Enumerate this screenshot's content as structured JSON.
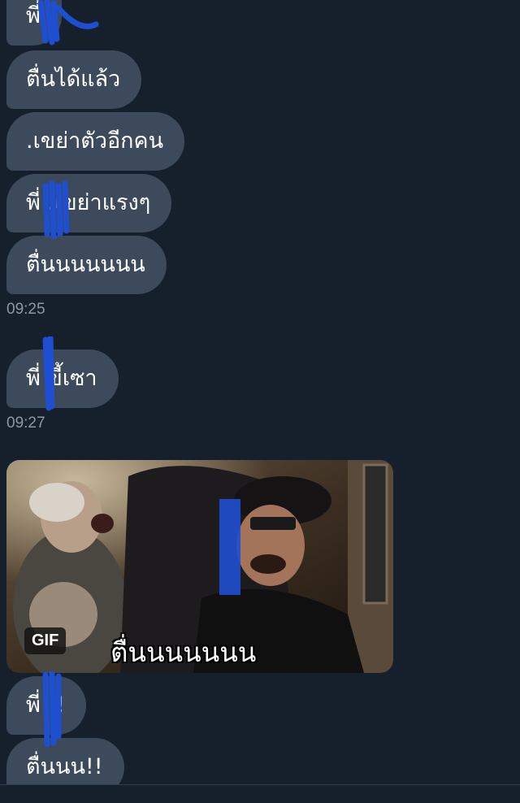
{
  "messages": [
    {
      "text": "พี่"
    },
    {
      "text": "ตื่นได้แล้ว"
    },
    {
      "text": ".เขย่าตัวอีกคน"
    },
    {
      "text": "พี่  .เขย่าแรงๆ"
    },
    {
      "text": "ตื่นนนนนนน"
    },
    {
      "text": "พี่  ขี้เซา"
    },
    {
      "text": "พี่  !!"
    },
    {
      "text": "ตื่นนน!!"
    }
  ],
  "timestamps": [
    "09:25",
    "09:27"
  ],
  "gif": {
    "badge": "GIF",
    "caption": "ตื่นนนนนนน"
  },
  "colors": {
    "background": "#16202c",
    "bubble": "#3c4a5b",
    "timestamp": "#8b98a5",
    "redaction": "#1f4fd1"
  }
}
